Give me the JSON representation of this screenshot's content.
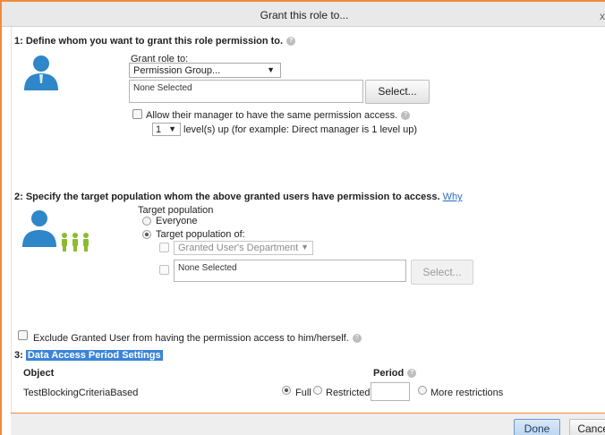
{
  "window": {
    "title": "Grant this role to...",
    "close_glyph": "x"
  },
  "section1": {
    "heading": "1: Define whom you want to grant this role permission to.",
    "grant_role_label": "Grant role to:",
    "grant_role_value": "Permission Group...",
    "selection_text": "None Selected",
    "select_button": "Select...",
    "manager_checkbox_label": "Allow their manager to have the same permission access.",
    "level_value": "1",
    "level_text": "level(s) up (for example: Direct manager is 1 level up)"
  },
  "section2": {
    "heading": "2: Specify the target population whom the above granted users have permission to access.",
    "why_link": "Why",
    "target_population_label": "Target population",
    "everyone_label": "Everyone",
    "target_population_of_label": "Target population of:",
    "department_value": "Granted User's Department",
    "selection_text": "None Selected",
    "select_button": "Select..."
  },
  "exclude_label": "Exclude Granted User from having the permission access to him/herself.",
  "section3": {
    "heading_prefix": "3:",
    "heading": "Data Access Period Settings",
    "object_header": "Object",
    "period_header": "Period",
    "row_object": "TestBlockingCriteriaBased",
    "full_label": "Full",
    "restricted_label": "Restricted",
    "more_restrictions_label": "More restrictions"
  },
  "footer": {
    "done_button": "Done",
    "cancel_button": "Cancel"
  },
  "colors": {
    "accent_border": "#f08a3c",
    "highlight": "#3b84d8",
    "link": "#2c6fbf",
    "person_icon": "#2f86c8",
    "group_icon": "#8dbb2e"
  }
}
